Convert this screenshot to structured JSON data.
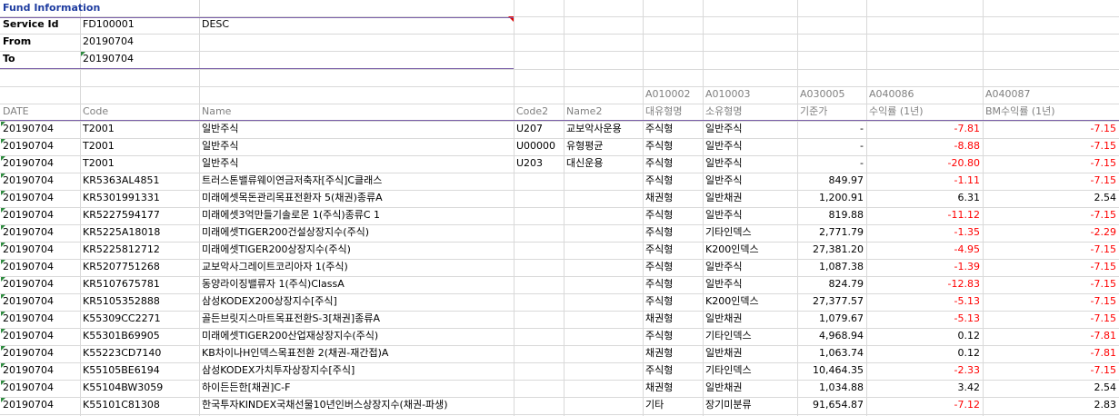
{
  "sheet": {
    "title": "Fund Information",
    "info": {
      "service_id_label": "Service Id",
      "service_id_value": "FD100001",
      "sort": "DESC",
      "from_label": "From",
      "from_value": "20190704",
      "to_label": "To",
      "to_value": "20190704"
    },
    "codes": [
      "A010002",
      "A010003",
      "A030005",
      "A040086",
      "A040087"
    ],
    "headers": [
      "DATE",
      "Code",
      "Name",
      "Code2",
      "Name2",
      "대유형명",
      "소유형명",
      "기준가",
      "수익률 (1년)",
      "BM수익률 (1년)"
    ],
    "rows": [
      {
        "date": "20190704",
        "code": "T2001",
        "name": "일반주식",
        "code2": "U207",
        "name2": "교보악사운용",
        "big": "주식형",
        "small": "일반주식",
        "nav": "-",
        "ret": "-7.81",
        "bm": "-7.15"
      },
      {
        "date": "20190704",
        "code": "T2001",
        "name": "일반주식",
        "code2": "U00000",
        "name2": "유형평균",
        "big": "주식형",
        "small": "일반주식",
        "nav": "-",
        "ret": "-8.88",
        "bm": "-7.15"
      },
      {
        "date": "20190704",
        "code": "T2001",
        "name": "일반주식",
        "code2": "U203",
        "name2": "대신운용",
        "big": "주식형",
        "small": "일반주식",
        "nav": "-",
        "ret": "-20.80",
        "bm": "-7.15"
      },
      {
        "date": "20190704",
        "code": "KR5363AL4851",
        "name": "트러스톤밸류웨이연금저축자[주식]C클래스",
        "code2": "",
        "name2": "",
        "big": "주식형",
        "small": "일반주식",
        "nav": "849.97",
        "ret": "-1.11",
        "bm": "-7.15"
      },
      {
        "date": "20190704",
        "code": "KR5301991331",
        "name": "미래에셋목돈관리목표전환자 5(채권)종류A",
        "code2": "",
        "name2": "",
        "big": "채권형",
        "small": "일반채권",
        "nav": "1,200.91",
        "ret": "6.31",
        "bm": "2.54"
      },
      {
        "date": "20190704",
        "code": "KR5227594177",
        "name": "미래에셋3억만들기솔로몬 1(주식)종류C 1",
        "code2": "",
        "name2": "",
        "big": "주식형",
        "small": "일반주식",
        "nav": "819.88",
        "ret": "-11.12",
        "bm": "-7.15"
      },
      {
        "date": "20190704",
        "code": "KR5225A18018",
        "name": "미래에셋TIGER200건설상장지수(주식)",
        "code2": "",
        "name2": "",
        "big": "주식형",
        "small": "기타인덱스",
        "nav": "2,771.79",
        "ret": "-1.35",
        "bm": "-2.29"
      },
      {
        "date": "20190704",
        "code": "KR5225812712",
        "name": "미래에셋TIGER200상장지수(주식)",
        "code2": "",
        "name2": "",
        "big": "주식형",
        "small": "K200인덱스",
        "nav": "27,381.20",
        "ret": "-4.95",
        "bm": "-7.15"
      },
      {
        "date": "20190704",
        "code": "KR5207751268",
        "name": "교보악사그레이트코리아자 1(주식)",
        "code2": "",
        "name2": "",
        "big": "주식형",
        "small": "일반주식",
        "nav": "1,087.38",
        "ret": "-1.39",
        "bm": "-7.15"
      },
      {
        "date": "20190704",
        "code": "KR5107675781",
        "name": "동양라이징밸류자 1(주식)ClassA",
        "code2": "",
        "name2": "",
        "big": "주식형",
        "small": "일반주식",
        "nav": "824.79",
        "ret": "-12.83",
        "bm": "-7.15"
      },
      {
        "date": "20190704",
        "code": "KR5105352888",
        "name": "삼성KODEX200상장지수[주식]",
        "code2": "",
        "name2": "",
        "big": "주식형",
        "small": "K200인덱스",
        "nav": "27,377.57",
        "ret": "-5.13",
        "bm": "-7.15"
      },
      {
        "date": "20190704",
        "code": "K55309CC2271",
        "name": "골든브릿지스마트목표전환S-3[채권]종류A",
        "code2": "",
        "name2": "",
        "big": "채권형",
        "small": "일반채권",
        "nav": "1,079.67",
        "ret": "-5.13",
        "bm": "-7.15"
      },
      {
        "date": "20190704",
        "code": "K55301B69905",
        "name": "미래에셋TIGER200산업재상장지수(주식)",
        "code2": "",
        "name2": "",
        "big": "주식형",
        "small": "기타인덱스",
        "nav": "4,968.94",
        "ret": "0.12",
        "bm": "-7.81"
      },
      {
        "date": "20190704",
        "code": "K55223CD7140",
        "name": "KB차이나H인덱스목표전환 2(채권-재간접)A",
        "code2": "",
        "name2": "",
        "big": "채권형",
        "small": "일반채권",
        "nav": "1,063.74",
        "ret": "0.12",
        "bm": "-7.81"
      },
      {
        "date": "20190704",
        "code": "K55105BE6194",
        "name": "삼성KODEX가치투자상장지수[주식]",
        "code2": "",
        "name2": "",
        "big": "주식형",
        "small": "기타인덱스",
        "nav": "10,464.35",
        "ret": "-2.33",
        "bm": "-7.15"
      },
      {
        "date": "20190704",
        "code": "K55104BW3059",
        "name": "하이든든한[채권]C-F",
        "code2": "",
        "name2": "",
        "big": "채권형",
        "small": "일반채권",
        "nav": "1,034.88",
        "ret": "3.42",
        "bm": "2.54"
      },
      {
        "date": "20190704",
        "code": "K55101C81308",
        "name": "한국투자KINDEX국채선물10년인버스상장지수(채권-파생)",
        "code2": "",
        "name2": "",
        "big": "기타",
        "small": "장기미분류",
        "nav": "91,654.87",
        "ret": "-7.12",
        "bm": "2.83"
      }
    ]
  }
}
